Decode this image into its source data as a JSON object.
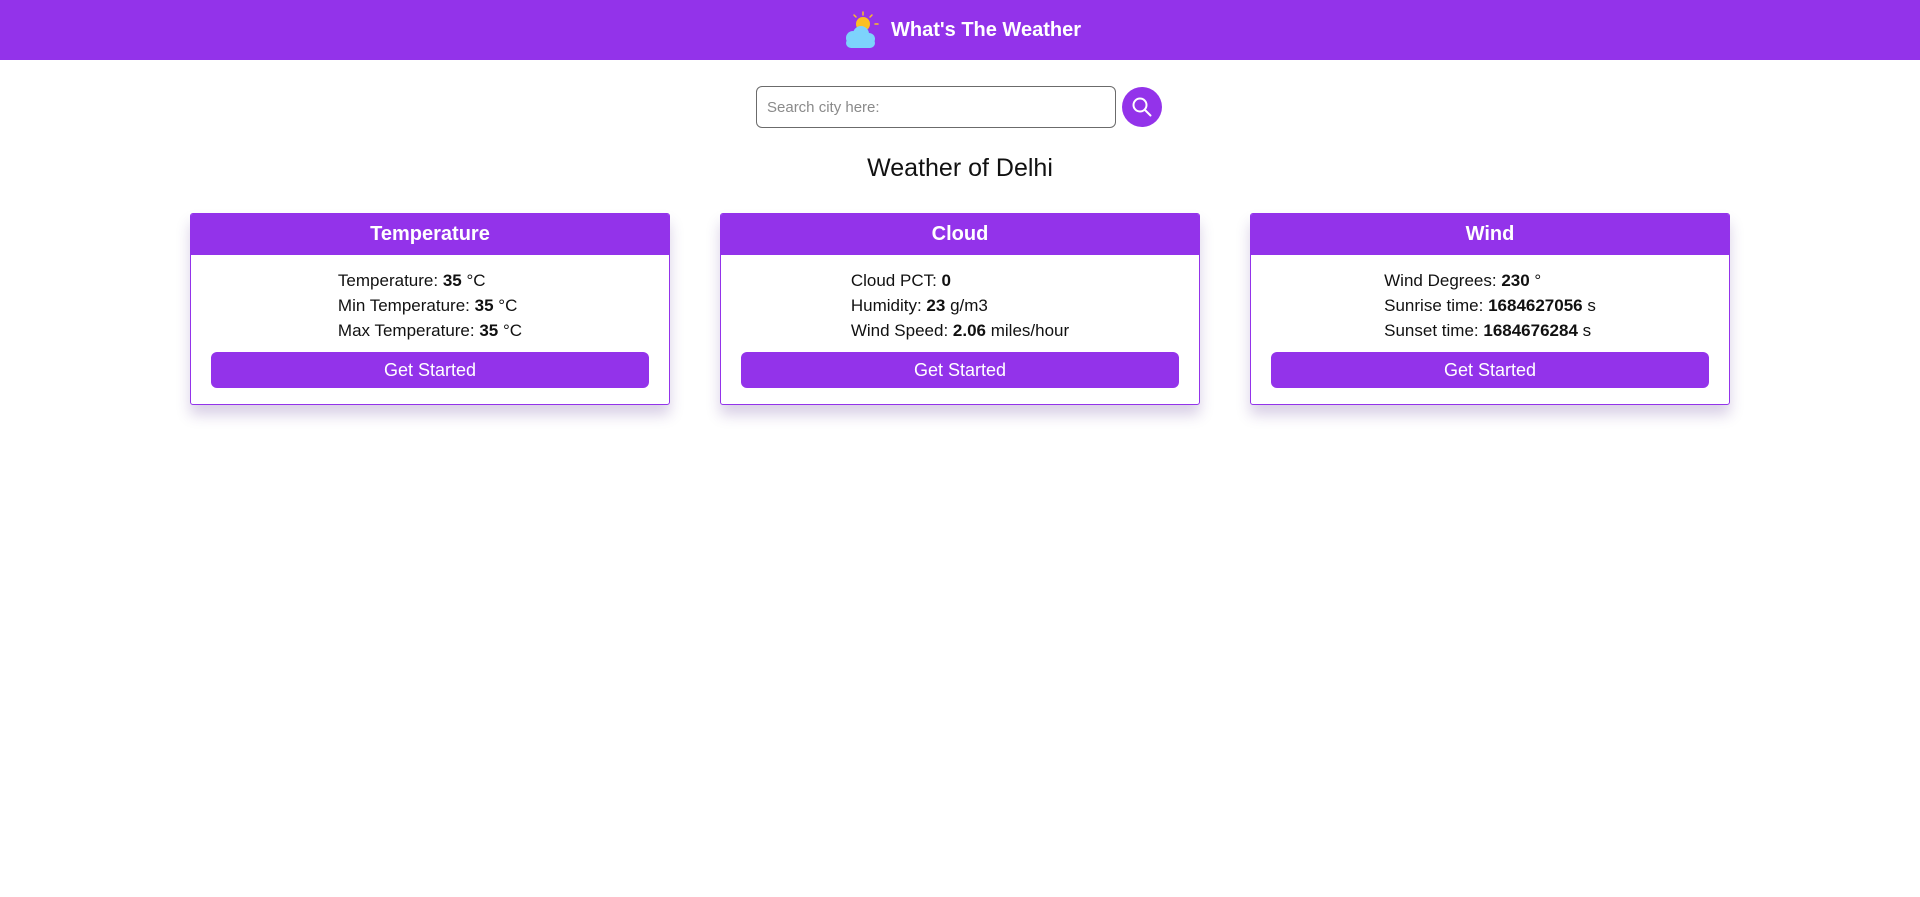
{
  "app": {
    "title": "What's The Weather"
  },
  "search": {
    "placeholder": "Search city here:",
    "value": ""
  },
  "heading": "Weather of Delhi",
  "cards": [
    {
      "title": "Temperature",
      "rows": [
        {
          "label": "Temperature: ",
          "value": "35",
          "unit": " °C"
        },
        {
          "label": "Min Temperature: ",
          "value": "35",
          "unit": " °C"
        },
        {
          "label": "Max Temperature: ",
          "value": "35",
          "unit": " °C"
        }
      ],
      "button": "Get Started"
    },
    {
      "title": "Cloud",
      "rows": [
        {
          "label": "Cloud PCT: ",
          "value": "0",
          "unit": ""
        },
        {
          "label": "Humidity: ",
          "value": "23",
          "unit": " g/m3"
        },
        {
          "label": "Wind Speed: ",
          "value": "2.06",
          "unit": " miles/hour"
        }
      ],
      "button": "Get Started"
    },
    {
      "title": "Wind",
      "rows": [
        {
          "label": "Wind Degrees: ",
          "value": "230",
          "unit": " °"
        },
        {
          "label": "Sunrise time: ",
          "value": "1684627056",
          "unit": " s"
        },
        {
          "label": "Sunset time: ",
          "value": "1684676284",
          "unit": " s"
        }
      ],
      "button": "Get Started"
    }
  ],
  "colors": {
    "accent": "#9333ea",
    "sun": "#fbbf24",
    "cloud": "#7dd3fc"
  },
  "icons": {
    "logo": "sun-behind-cloud-icon",
    "search": "search-icon"
  }
}
